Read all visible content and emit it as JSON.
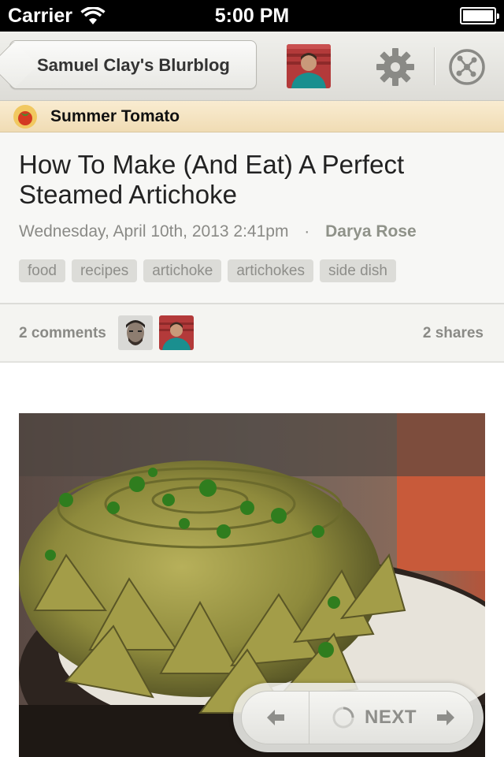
{
  "status_bar": {
    "carrier": "Carrier",
    "time": "5:00 PM"
  },
  "nav": {
    "back_label": "Samuel Clay's Blurblog",
    "settings_icon": "gear-icon",
    "explore_icon": "compass-icon"
  },
  "feed": {
    "title": "Summer Tomato"
  },
  "story": {
    "title": "How To Make (And Eat) A Perfect Steamed Artichoke",
    "date": "Wednesday, April 10th, 2013 2:41pm",
    "separator": "·",
    "author": "Darya Rose",
    "tags": [
      "food",
      "recipes",
      "artichoke",
      "artichokes",
      "side dish"
    ]
  },
  "comments": {
    "count_label": "2 comments",
    "shares_label": "2 shares"
  },
  "traverse": {
    "next_label": "NEXT"
  },
  "colors": {
    "nav_bg": "#e7e6e2",
    "feed_bar": "#f5e5c3",
    "tag_bg": "#dcdcd8",
    "meta_text": "#8a8a86"
  }
}
